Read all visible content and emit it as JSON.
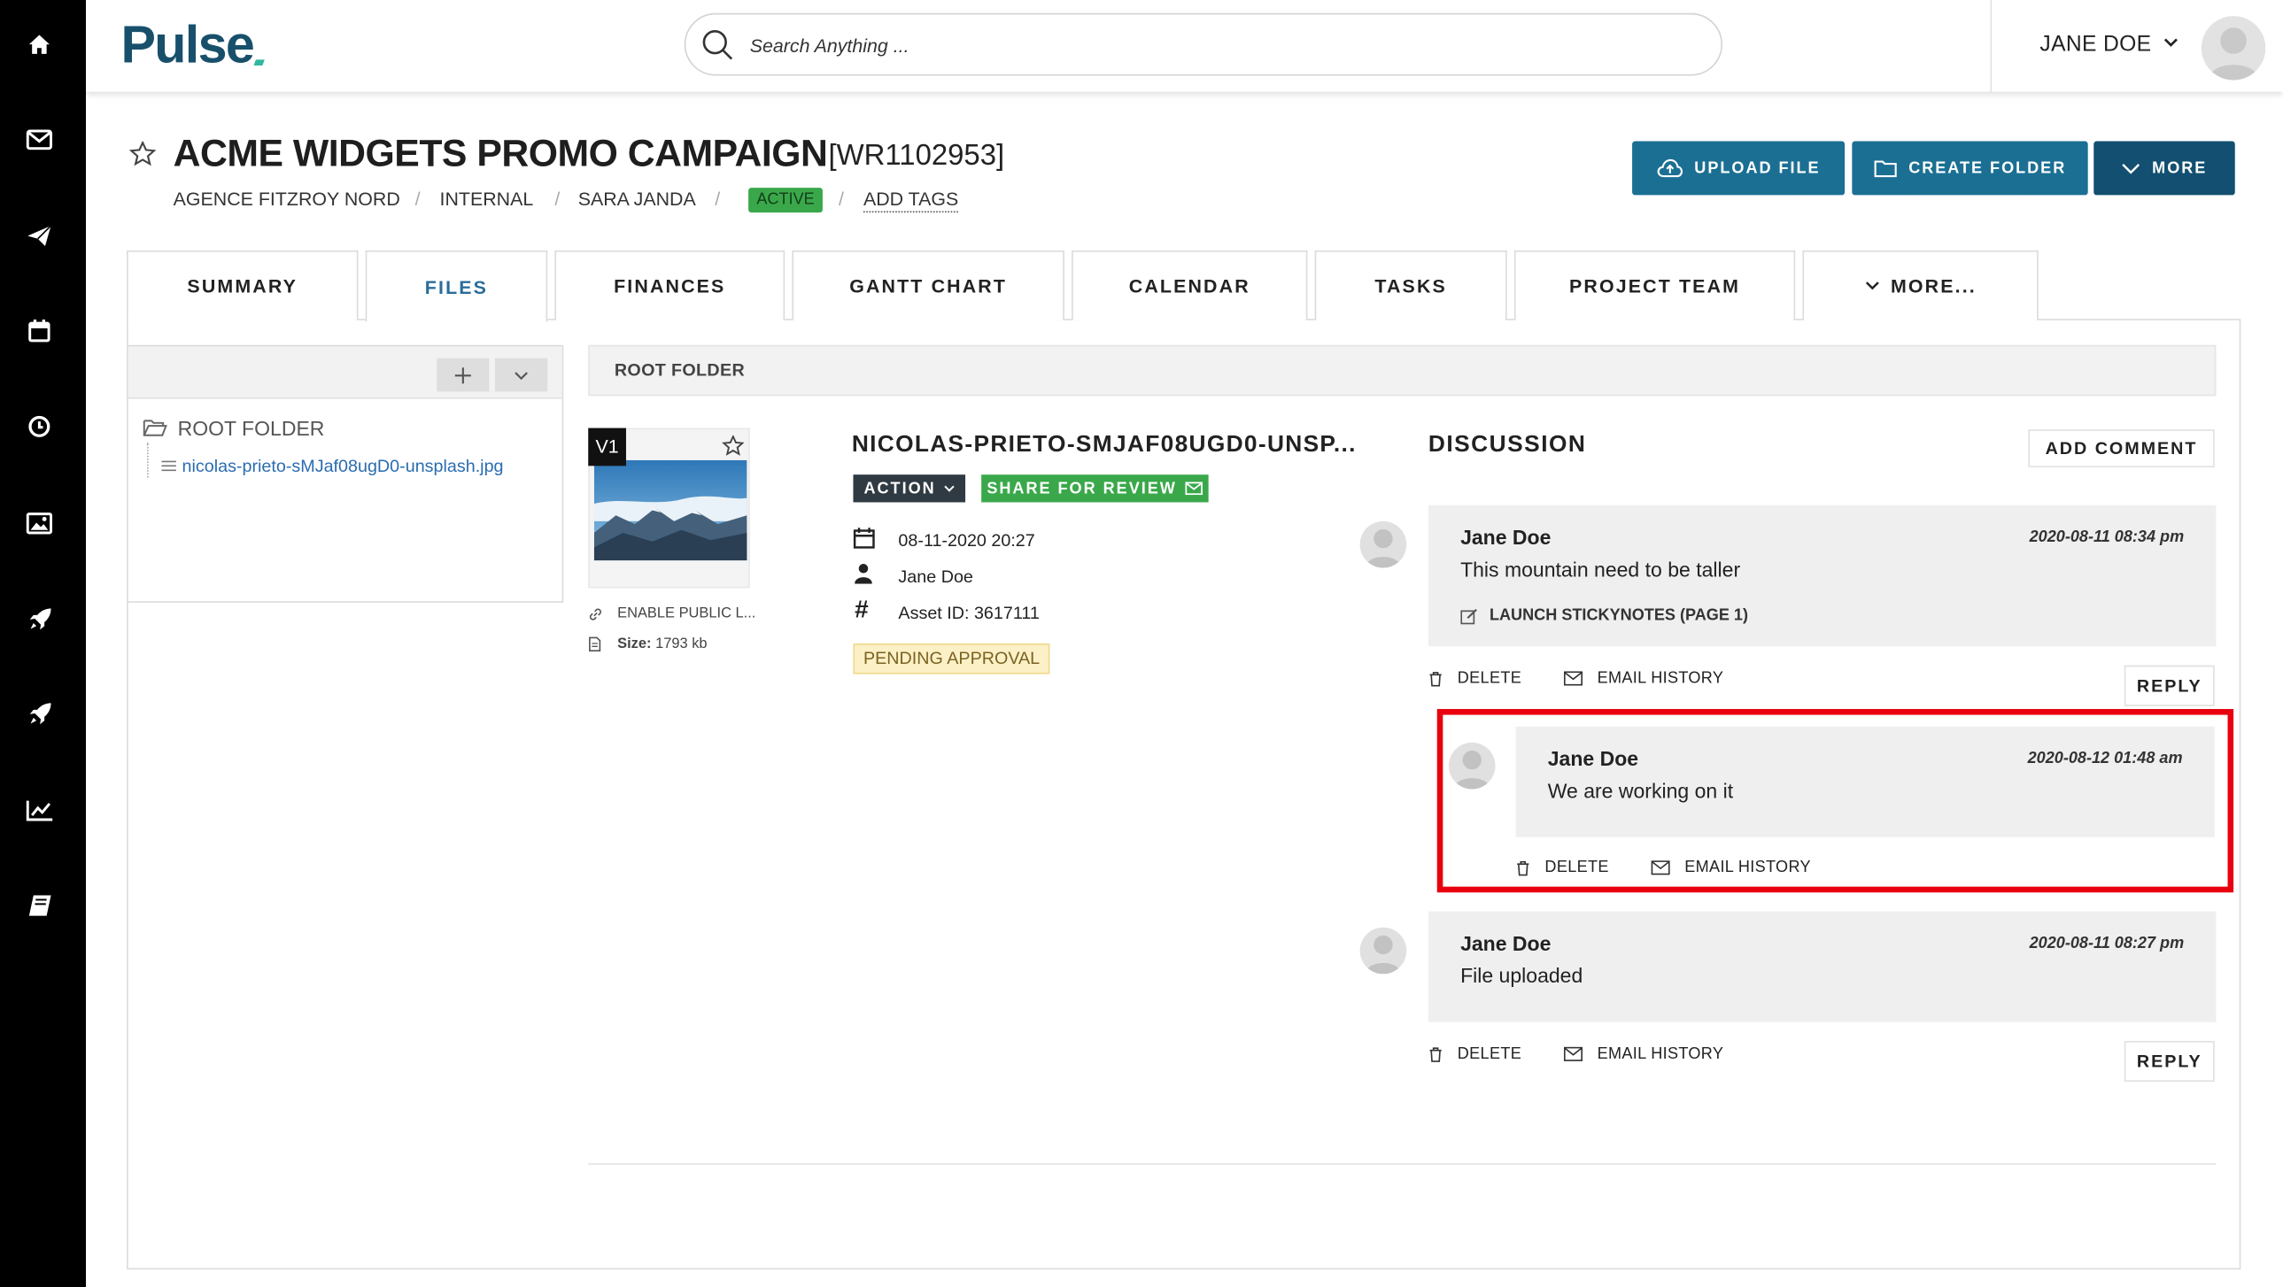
{
  "app": {
    "logo": "Pulse",
    "user_name": "JANE DOE"
  },
  "search": {
    "placeholder": "Search Anything ..."
  },
  "sidebar": {
    "icons": [
      "home-icon",
      "mail-icon",
      "send-icon",
      "calendar-icon",
      "clock-icon",
      "image-icon",
      "rocket-icon",
      "rocket-alt-icon",
      "chart-icon",
      "book-icon"
    ]
  },
  "project": {
    "title": "ACME WIDGETS PROMO CAMPAIGN",
    "code": "[WR1102953]",
    "breadcrumb": [
      "AGENCE FITZROY NORD",
      "INTERNAL",
      "SARA JANDA"
    ],
    "separator": "/",
    "status": "ACTIVE",
    "add_tags": "ADD TAGS"
  },
  "toolbar": {
    "upload": "UPLOAD FILE",
    "create_folder": "CREATE FOLDER",
    "more": "MORE"
  },
  "tabs": [
    "SUMMARY",
    "FILES",
    "FINANCES",
    "GANTT CHART",
    "CALENDAR",
    "TASKS",
    "PROJECT TEAM",
    "MORE..."
  ],
  "active_tab": "FILES",
  "tree": {
    "root": "ROOT FOLDER",
    "file": "nicolas-prieto-sMJaf08ugD0-unsplash.jpg"
  },
  "folder_header": "ROOT FOLDER",
  "file": {
    "version": "V1",
    "name": "NICOLAS-PRIETO-SMJAF08UGD0-UNSP...",
    "action_label": "ACTION",
    "share_label": "SHARE FOR REVIEW",
    "date": "08-11-2020 20:27",
    "owner": "Jane Doe",
    "asset_id": "Asset ID: 3617111",
    "status": "PENDING APPROVAL",
    "public_link": "ENABLE PUBLIC L...",
    "size_label": "Size:",
    "size_value": "1793 kb"
  },
  "discussion": {
    "title": "DISCUSSION",
    "add_comment": "ADD COMMENT",
    "delete_label": "DELETE",
    "email_history_label": "EMAIL HISTORY",
    "reply_label": "REPLY",
    "comments": [
      {
        "author": "Jane Doe",
        "date": "2020-08-11 08:34 pm",
        "text": "This mountain need to be taller",
        "link": "LAUNCH STICKYNOTES (PAGE 1)"
      },
      {
        "author": "Jane Doe",
        "date": "2020-08-12 01:48 am",
        "text": "We are working on it"
      },
      {
        "author": "Jane Doe",
        "date": "2020-08-11 08:27 pm",
        "text": "File uploaded"
      }
    ]
  },
  "colors": {
    "sidebar": "#000000",
    "primary_button": "#1b6f93",
    "more_button": "#124f70",
    "active_badge": "#3aa84a",
    "share_green": "#3aa84a",
    "action_dark": "#2f3a42",
    "pending_bg": "#fcf0c7",
    "highlight": "#e8000f",
    "tab_active": "#2a6d9c",
    "logo": "#18506b"
  }
}
